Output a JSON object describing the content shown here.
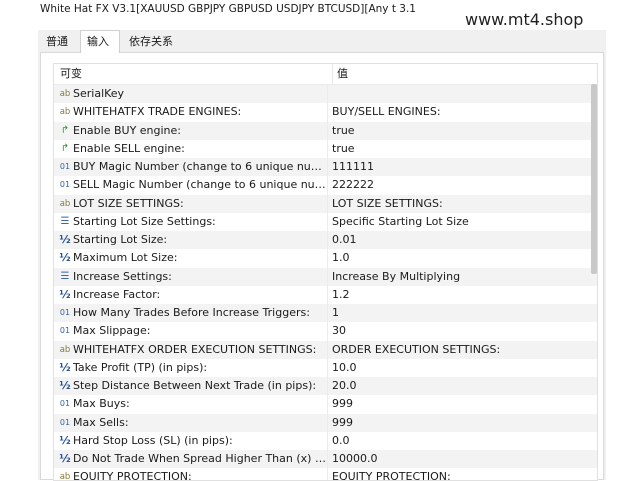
{
  "window": {
    "title": "White Hat FX V3.1[XAUUSD GBPJPY GBPUSD USDJPY BTCUSD][Any t 3.1"
  },
  "watermark": "www.mt4.shop",
  "tabs": [
    {
      "label": "普通"
    },
    {
      "label": "输入"
    },
    {
      "label": "依存关系"
    }
  ],
  "table": {
    "headers": [
      "可变",
      "值"
    ],
    "rows": [
      {
        "icon": "ab",
        "name": "SerialKey",
        "value": ""
      },
      {
        "icon": "ab",
        "name": "WHITEHATFX TRADE ENGINES:",
        "value": "BUY/SELL ENGINES:"
      },
      {
        "icon": "flag",
        "name": "Enable BUY engine:",
        "value": "true"
      },
      {
        "icon": "flag",
        "name": "Enable SELL engine:",
        "value": "true"
      },
      {
        "icon": "01",
        "name": "BUY Magic Number (change to 6 unique numb...",
        "value": "111111"
      },
      {
        "icon": "01",
        "name": "SELL Magic Number (change to 6 unique numb...",
        "value": "222222"
      },
      {
        "icon": "ab",
        "name": "LOT SIZE SETTINGS:",
        "value": "LOT SIZE SETTINGS:"
      },
      {
        "icon": "list",
        "name": "Starting Lot Size Settings:",
        "value": "Specific Starting Lot Size"
      },
      {
        "icon": "½",
        "name": "Starting Lot Size:",
        "value": "0.01"
      },
      {
        "icon": "½",
        "name": "Maximum Lot Size:",
        "value": "1.0"
      },
      {
        "icon": "list",
        "name": "Increase Settings:",
        "value": "Increase By Multiplying"
      },
      {
        "icon": "½",
        "name": "Increase Factor:",
        "value": "1.2"
      },
      {
        "icon": "01",
        "name": "How Many Trades Before Increase Triggers:",
        "value": "1"
      },
      {
        "icon": "01",
        "name": "Max Slippage:",
        "value": "30"
      },
      {
        "icon": "ab",
        "name": "WHITEHATFX ORDER EXECUTION SETTINGS:",
        "value": "ORDER EXECUTION SETTINGS:"
      },
      {
        "icon": "½",
        "name": "Take Profit (TP) (in pips):",
        "value": "10.0"
      },
      {
        "icon": "½",
        "name": "Step Distance Between Next Trade (in pips):",
        "value": "20.0"
      },
      {
        "icon": "01",
        "name": "Max Buys:",
        "value": "999"
      },
      {
        "icon": "01",
        "name": "Max Sells:",
        "value": "999"
      },
      {
        "icon": "½",
        "name": "Hard Stop Loss (SL) (in pips):",
        "value": "0.0"
      },
      {
        "icon": "½",
        "name": "Do Not Trade When Spread Higher Than (x) Pi...",
        "value": "10000.0"
      },
      {
        "icon": "ab",
        "name": "EQUITY PROTECTION:",
        "value": "EQUITY PROTECTION:"
      }
    ]
  },
  "icons": {
    "ab": "string-type-icon",
    "flag": "bool-type-icon",
    "01": "integer-type-icon",
    "½": "double-type-icon",
    "list": "enum-type-icon"
  }
}
